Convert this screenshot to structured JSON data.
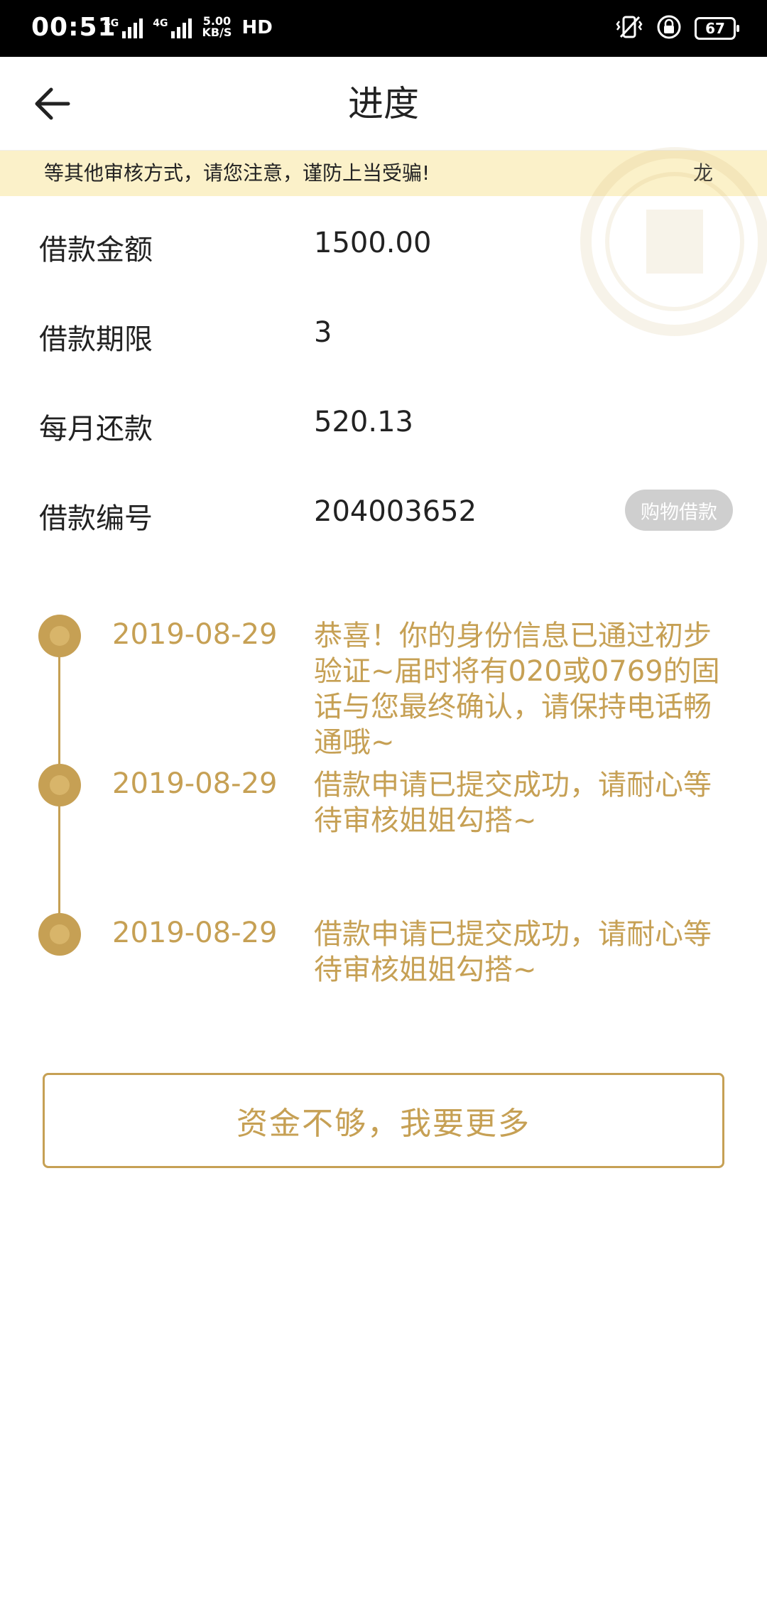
{
  "status_bar": {
    "time": "00:51",
    "network_1": "4G",
    "network_2": "4G",
    "speed_value": "5.00",
    "speed_unit": "KB/S",
    "hd_label": "HD",
    "battery_level": "67"
  },
  "header": {
    "title": "进度",
    "back_icon": "arrow-left-icon"
  },
  "notice": {
    "text": "等其他审核方式，请您注意，谨防上当受骗!",
    "tail_text": "龙"
  },
  "info": {
    "rows": [
      {
        "label": "借款金额",
        "value": "1500.00"
      },
      {
        "label": "借款期限",
        "value": "3"
      },
      {
        "label": "每月还款",
        "value": "520.13"
      },
      {
        "label": "借款编号",
        "value": "204003652",
        "badge": "购物借款"
      }
    ]
  },
  "timeline": {
    "items": [
      {
        "date": "2019-08-29",
        "text": "恭喜！你的身份信息已通过初步验证~届时将有020或0769的固话与您最终确认，请保持电话畅通哦~"
      },
      {
        "date": "2019-08-29",
        "text": "借款申请已提交成功，请耐心等待审核姐姐勾搭~"
      },
      {
        "date": "2019-08-29",
        "text": "借款申请已提交成功，请耐心等待审核姐姐勾搭~"
      }
    ]
  },
  "actions": {
    "more_label": "资金不够，我要更多"
  },
  "colors": {
    "accent": "#c6a054",
    "notice_bg": "#fbf1c9",
    "badge_bg": "#cfcfcf"
  }
}
